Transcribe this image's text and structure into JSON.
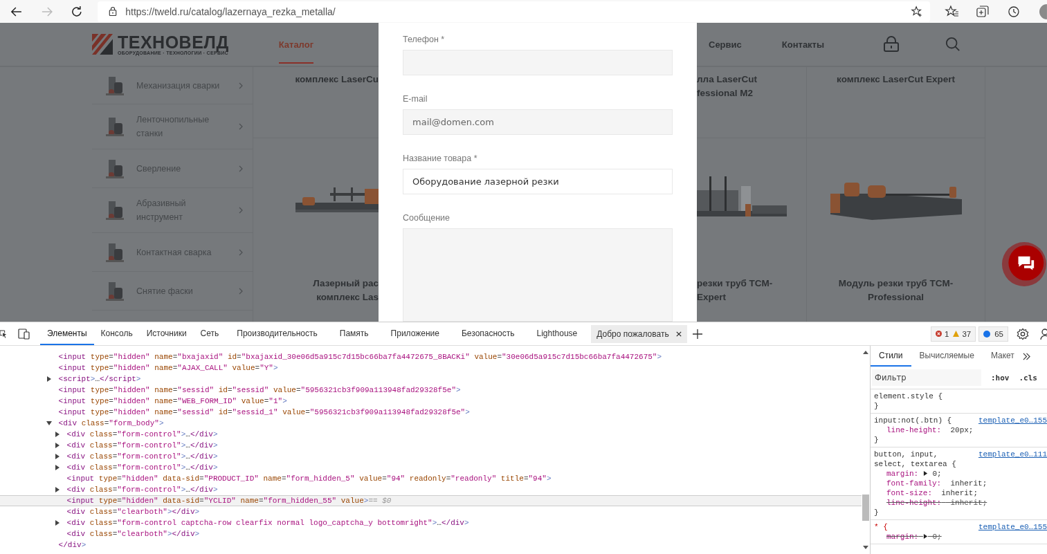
{
  "browser": {
    "url": "https://tweld.ru/catalog/lazernaya_rezka_metalla/",
    "back_disabled": false,
    "forward_disabled": true
  },
  "site": {
    "logo": {
      "name": "ТЕХНОВЕЛД",
      "tagline": "ОБОРУДОВАНИЕ · ТЕХНОЛОГИИ · СЕРВИС"
    },
    "nav_left": [
      {
        "label": "Каталог",
        "selected": true
      }
    ],
    "nav_right": [
      {
        "label": "Сервис",
        "selected": false
      },
      {
        "label": "Контакты",
        "selected": false
      }
    ],
    "sidebar": [
      {
        "label": "Механизация сварки"
      },
      {
        "label": "Ленточнопильные станки"
      },
      {
        "label": "Сверление"
      },
      {
        "label": "Абразивный инструмент"
      },
      {
        "label": "Контактная сварка"
      },
      {
        "label": "Снятие фаски"
      }
    ],
    "products_left": {
      "top": [
        "комплекс LaserCu"
      ],
      "bottom": [
        "Лазерный рас",
        "комплекс Las"
      ]
    },
    "products_right": [
      {
        "top": [
          "лла LaserCut",
          "fessional M2"
        ],
        "bottom": [
          "резки труб TCM-",
          "Expert"
        ]
      },
      {
        "top": [
          "комплекс LaserCut Expert"
        ],
        "bottom": [
          "Модуль резки труб TCM-",
          "Professional"
        ]
      }
    ]
  },
  "form": {
    "fields": [
      {
        "kind": "input",
        "label": "Телефон *"
      },
      {
        "kind": "input",
        "label": "E-mail",
        "placeholder": "mail@domen.com"
      },
      {
        "kind": "input",
        "label": "Название товара *",
        "value": "Оборудование лазерной резки"
      },
      {
        "kind": "textarea",
        "label": "Сообщение"
      }
    ]
  },
  "devtools": {
    "tabs": [
      {
        "label": "Элементы",
        "selected": true,
        "closable": false
      },
      {
        "label": "Консоль",
        "selected": false,
        "closable": false
      },
      {
        "label": "Источники",
        "selected": false,
        "closable": false
      },
      {
        "label": "Сеть",
        "selected": false,
        "closable": false
      },
      {
        "label": "Производительность",
        "selected": false,
        "closable": false
      },
      {
        "label": "Память",
        "selected": false,
        "closable": false
      },
      {
        "label": "Приложение",
        "selected": false,
        "closable": false
      },
      {
        "label": "Безопасность",
        "selected": false,
        "closable": false
      },
      {
        "label": "Lighthouse",
        "selected": false,
        "closable": false
      },
      {
        "label": "Добро пожаловать",
        "selected": false,
        "closable": true
      }
    ],
    "counters": [
      {
        "kind": "error",
        "count": "1"
      },
      {
        "kind": "warning",
        "count": "37"
      },
      {
        "kind": "info",
        "count": "65"
      }
    ],
    "dom": [
      {
        "text": "<input type=\"hidden\" name=\"bxajaxid\" id=\"bxajaxid_30e06d5a915c7d15bc66ba7fa4472675_8BACKi\" value=\"30e06d5a915c7d15bc66ba7fa4472675\">",
        "selected": false
      },
      {
        "text": "<input type=\"hidden\" name=\"AJAX_CALL\" value=\"Y\">",
        "selected": false
      },
      {
        "text": "<script>…</script>",
        "selected": false,
        "expanded": false
      },
      {
        "text": "<input type=\"hidden\" name=\"sessid\" id=\"sessid\" value=\"5956321cb3f909a113948fad29328f5e\">",
        "selected": false
      },
      {
        "text": "<input type=\"hidden\" name=\"WEB_FORM_ID\" value=\"1\">",
        "selected": false
      },
      {
        "text": "<input type=\"hidden\" name=\"sessid\" id=\"sessid_1\" value=\"5956321cb3f909a113948fad29328f5e\">",
        "selected": false
      },
      {
        "text": "<div class=\"form_body\">",
        "selected": false,
        "expanded": true,
        "children": [
          {
            "text": "<div class=\"form-control\">…</div>",
            "selected": false,
            "expanded": false
          },
          {
            "text": "<div class=\"form-control\">…</div>",
            "selected": false,
            "expanded": false
          },
          {
            "text": "<div class=\"form-control\">…</div>",
            "selected": false,
            "expanded": false
          },
          {
            "text": "<div class=\"form-control\">…</div>",
            "selected": false,
            "expanded": false
          },
          {
            "text": "<input type=\"hidden\" data-sid=\"PRODUCT_ID\" name=\"form_hidden_5\" value=\"94\" readonly=\"readonly\" title=\"94\">",
            "selected": false
          },
          {
            "text": "<div class=\"form-control\">…</div>",
            "selected": false,
            "expanded": false
          },
          {
            "text": "<input type=\"hidden\" data-sid=\"YCLID\" name=\"form_hidden_55\" value>",
            "selected": true,
            "suffix": "== $0"
          },
          {
            "text": "<div class=\"clearboth\"></div>",
            "selected": false
          },
          {
            "text": "<div class=\"form-control captcha-row clearfix normal logo_captcha_y bottomright\">…</div>",
            "selected": false,
            "expanded": false
          },
          {
            "text": "<div class=\"clearboth\"></div>",
            "selected": false
          }
        ]
      },
      {
        "text": "</div>",
        "selected": false
      }
    ],
    "styles": {
      "tabs": [
        {
          "label": "Стили",
          "selected": true
        },
        {
          "label": "Вычисляемые",
          "selected": false
        },
        {
          "label": "Макет",
          "selected": false
        }
      ],
      "filter_placeholder": "Фильтр",
      "buttons": [
        ":hov",
        ".cls"
      ],
      "rules": [
        {
          "selector": [
            "element.style {"
          ],
          "close": "}"
        },
        {
          "selector": [
            "input:not(.btn) {"
          ],
          "source": "template_e0…155",
          "decls": [
            {
              "prop": "line-height:",
              "value": "20px;",
              "struck": false,
              "expandable": false
            }
          ],
          "close": "}"
        },
        {
          "selector": [
            "button, input,",
            "select, textarea {"
          ],
          "source": "template_e0…111",
          "decls": [
            {
              "prop": "margin:",
              "value": "0;",
              "struck": false,
              "expandable": true
            },
            {
              "prop": "font-family:",
              "value": "inherit;",
              "struck": false,
              "expandable": false
            },
            {
              "prop": "font-size:",
              "value": "inherit;",
              "struck": false,
              "expandable": false
            },
            {
              "prop": "line-height:",
              "value": "inherit;",
              "struck": true,
              "expandable": false
            }
          ],
          "close": "}"
        },
        {
          "selector": [
            "* {"
          ],
          "source": "template_e0…155",
          "decls": [
            {
              "prop": "margin:",
              "value": "0;",
              "struck": true,
              "expandable": true
            }
          ]
        }
      ]
    }
  }
}
